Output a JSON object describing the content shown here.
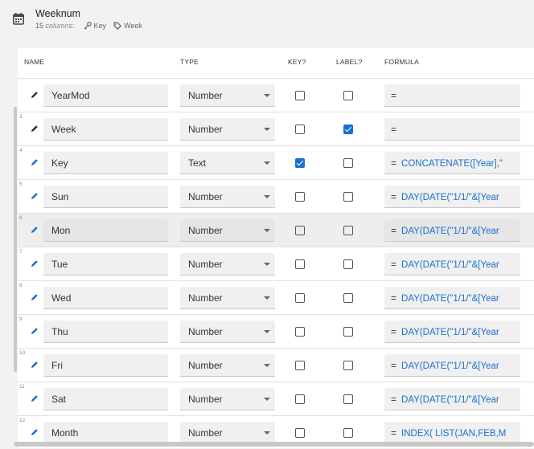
{
  "table": {
    "title": "Weeknum",
    "columns_count": "15",
    "columns_label": "columns:",
    "key_tag": "Key",
    "label_tag": "Week"
  },
  "headers": {
    "name": "NAME",
    "type": "TYPE",
    "key": "KEY?",
    "label": "LABEL?",
    "formula": "FORMULA"
  },
  "rows": [
    {
      "num": "",
      "name": "YearMod",
      "type": "Number",
      "key": false,
      "label": false,
      "formula": ""
    },
    {
      "num": "3",
      "name": "Week",
      "type": "Number",
      "key": false,
      "label": true,
      "formula": ""
    },
    {
      "num": "4",
      "name": "Key",
      "type": "Text",
      "key": true,
      "label": false,
      "formula": "CONCATENATE([Year],\""
    },
    {
      "num": "5",
      "name": "Sun",
      "type": "Number",
      "key": false,
      "label": false,
      "formula": "DAY(DATE(\"1/1/\"&[Year"
    },
    {
      "num": "6",
      "name": "Mon",
      "type": "Number",
      "key": false,
      "label": false,
      "formula": "DAY(DATE(\"1/1/\"&[Year"
    },
    {
      "num": "7",
      "name": "Tue",
      "type": "Number",
      "key": false,
      "label": false,
      "formula": "DAY(DATE(\"1/1/\"&[Year"
    },
    {
      "num": "8",
      "name": "Wed",
      "type": "Number",
      "key": false,
      "label": false,
      "formula": "DAY(DATE(\"1/1/\"&[Year"
    },
    {
      "num": "9",
      "name": "Thu",
      "type": "Number",
      "key": false,
      "label": false,
      "formula": "DAY(DATE(\"1/1/\"&[Year"
    },
    {
      "num": "10",
      "name": "Fri",
      "type": "Number",
      "key": false,
      "label": false,
      "formula": "DAY(DATE(\"1/1/\"&[Year"
    },
    {
      "num": "11",
      "name": "Sat",
      "type": "Number",
      "key": false,
      "label": false,
      "formula": "DAY(DATE(\"1/1/\"&[Year"
    },
    {
      "num": "12",
      "name": "Month",
      "type": "Number",
      "key": false,
      "label": false,
      "formula": "INDEX(  LIST(JAN,FEB,M"
    }
  ],
  "hover_row": "Mon",
  "formula_prefix": "=",
  "icons": {
    "table": "calendar-icon",
    "key": "key-icon",
    "label": "tag-icon",
    "edit": "pencil-icon"
  },
  "colors": {
    "accent": "#1a6fd0",
    "formula_text": "#1a6fd0"
  }
}
